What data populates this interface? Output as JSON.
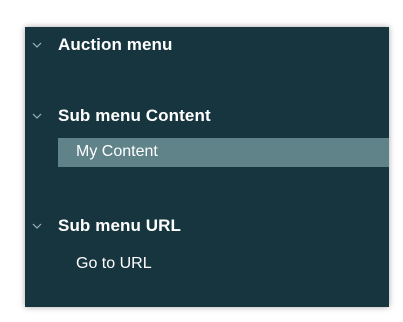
{
  "menu": {
    "sections": [
      {
        "title": "Auction menu",
        "expanded": true,
        "chevron_icon": "chevron-down-icon",
        "items": []
      },
      {
        "title": "Sub menu Content",
        "expanded": true,
        "chevron_icon": "chevron-down-icon",
        "items": [
          {
            "label": "My Content",
            "selected": true
          }
        ]
      },
      {
        "title": "Sub menu URL",
        "expanded": true,
        "chevron_icon": "chevron-down-icon",
        "items": [
          {
            "label": "Go to URL",
            "selected": false
          }
        ]
      }
    ]
  },
  "colors": {
    "panel_background": "#17353f",
    "selected_item_background": "#5f8389",
    "text": "#ffffff",
    "chevron": "#9fb3b8"
  }
}
